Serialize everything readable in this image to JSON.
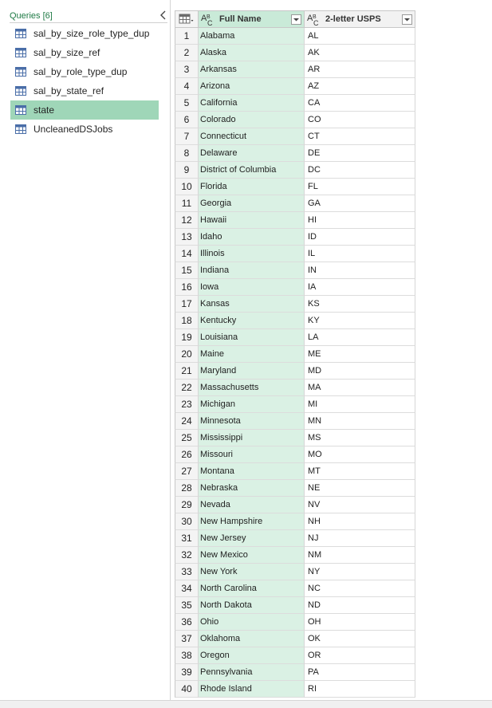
{
  "queries_pane": {
    "title": "Queries [6]",
    "items": [
      {
        "label": "sal_by_size_role_type_dup",
        "selected": false
      },
      {
        "label": "sal_by_size_ref",
        "selected": false
      },
      {
        "label": "sal_by_role_type_dup",
        "selected": false
      },
      {
        "label": "sal_by_state_ref",
        "selected": false
      },
      {
        "label": "state",
        "selected": true
      },
      {
        "label": "UncleanedDSJobs",
        "selected": false
      }
    ]
  },
  "grid": {
    "columns": [
      {
        "name": "Full Name",
        "type": "text"
      },
      {
        "name": "2-letter USPS",
        "type": "text"
      }
    ],
    "rows": [
      [
        "1",
        "Alabama",
        "AL"
      ],
      [
        "2",
        "Alaska",
        "AK"
      ],
      [
        "3",
        "Arkansas",
        "AR"
      ],
      [
        "4",
        "Arizona",
        "AZ"
      ],
      [
        "5",
        "California",
        "CA"
      ],
      [
        "6",
        "Colorado",
        "CO"
      ],
      [
        "7",
        "Connecticut",
        "CT"
      ],
      [
        "8",
        "Delaware",
        "DE"
      ],
      [
        "9",
        "District of Columbia",
        "DC"
      ],
      [
        "10",
        "Florida",
        "FL"
      ],
      [
        "11",
        "Georgia",
        "GA"
      ],
      [
        "12",
        "Hawaii",
        "HI"
      ],
      [
        "13",
        "Idaho",
        "ID"
      ],
      [
        "14",
        "Illinois",
        "IL"
      ],
      [
        "15",
        "Indiana",
        "IN"
      ],
      [
        "16",
        "Iowa",
        "IA"
      ],
      [
        "17",
        "Kansas",
        "KS"
      ],
      [
        "18",
        "Kentucky",
        "KY"
      ],
      [
        "19",
        "Louisiana",
        "LA"
      ],
      [
        "20",
        "Maine",
        "ME"
      ],
      [
        "21",
        "Maryland",
        "MD"
      ],
      [
        "22",
        "Massachusetts",
        "MA"
      ],
      [
        "23",
        "Michigan",
        "MI"
      ],
      [
        "24",
        "Minnesota",
        "MN"
      ],
      [
        "25",
        "Mississippi",
        "MS"
      ],
      [
        "26",
        "Missouri",
        "MO"
      ],
      [
        "27",
        "Montana",
        "MT"
      ],
      [
        "28",
        "Nebraska",
        "NE"
      ],
      [
        "29",
        "Nevada",
        "NV"
      ],
      [
        "30",
        "New Hampshire",
        "NH"
      ],
      [
        "31",
        "New Jersey",
        "NJ"
      ],
      [
        "32",
        "New Mexico",
        "NM"
      ],
      [
        "33",
        "New York",
        "NY"
      ],
      [
        "34",
        "North Carolina",
        "NC"
      ],
      [
        "35",
        "North Dakota",
        "ND"
      ],
      [
        "36",
        "Ohio",
        "OH"
      ],
      [
        "37",
        "Oklahoma",
        "OK"
      ],
      [
        "38",
        "Oregon",
        "OR"
      ],
      [
        "39",
        "Pennsylvania",
        "PA"
      ],
      [
        "40",
        "Rhode Island",
        "RI"
      ]
    ]
  },
  "colors": {
    "accent": "#1f7a45",
    "selected_query_bg": "#9fd6b8",
    "selected_column_bg": "#daf1e4"
  }
}
